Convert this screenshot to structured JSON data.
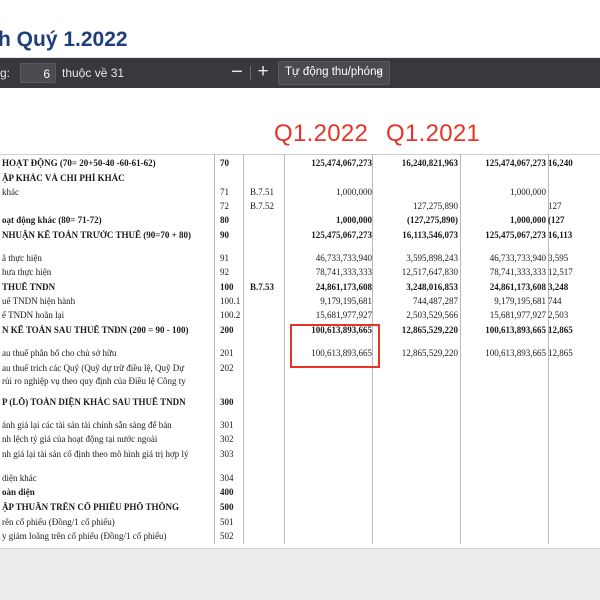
{
  "header": {
    "title": "h Quý 1.2022"
  },
  "toolbar": {
    "page_label": "g:",
    "page_value": "6",
    "page_of": "thuộc về 31",
    "zoom_out": "−",
    "zoom_in": "+",
    "zoom_select": "Tự động thu/phóng"
  },
  "annotations": {
    "q1_2022": "Q1.2022",
    "q1_2021": "Q1.2021"
  },
  "table": {
    "rows": [
      {
        "label": "HOẠT ĐỘNG (70= 20+50-40 -60-61-62)",
        "code": "70",
        "note": "",
        "v1": "125,474,067,273",
        "v2": "16,240,821,963",
        "v3": "125,474,067,273",
        "v4": "16,240",
        "bold": true
      },
      {
        "label": "ẬP KHÁC VÀ CHI PHÍ KHÁC",
        "code": "",
        "note": "",
        "v1": "",
        "v2": "",
        "v3": "",
        "v4": "",
        "bold": true
      },
      {
        "label": "khác",
        "code": "71",
        "note": "B.7.51",
        "v1": "1,000,000",
        "v2": "",
        "v3": "1,000,000",
        "v4": "",
        "bold": false
      },
      {
        "label": "",
        "code": "72",
        "note": "B.7.52",
        "v1": "",
        "v2": "127,275,890",
        "v3": "",
        "v4": "127",
        "bold": false
      },
      {
        "label": "oạt động khác (80= 71-72)",
        "code": "80",
        "note": "",
        "v1": "1,000,000",
        "v2": "(127,275,890)",
        "v3": "1,000,000",
        "v4": "(127",
        "bold": true
      },
      {
        "label": "NHUẬN KẾ TOÁN TRƯỚC THUẾ (90=70 + 80)",
        "code": "90",
        "note": "",
        "v1": "125,475,067,273",
        "v2": "16,113,546,073",
        "v3": "125,475,067,273",
        "v4": "16,113",
        "bold": true
      },
      {
        "label": "ã thực hiện",
        "code": "91",
        "note": "",
        "v1": "46,733,733,940",
        "v2": "3,595,898,243",
        "v3": "46,733,733,940",
        "v4": "3,595",
        "bold": false
      },
      {
        "label": "hưa thực hiện",
        "code": "92",
        "note": "",
        "v1": "78,741,333,333",
        "v2": "12,517,647,830",
        "v3": "78,741,333,333",
        "v4": "12,517",
        "bold": false
      },
      {
        "label": "THUẾ TNDN",
        "code": "100",
        "note": "B.7.53",
        "v1": "24,861,173,608",
        "v2": "3,248,016,853",
        "v3": "24,861,173,608",
        "v4": "3,248",
        "bold": true
      },
      {
        "label": "uế TNDN hiện hành",
        "code": "100.1",
        "note": "",
        "v1": "9,179,195,681",
        "v2": "744,487,287",
        "v3": "9,179,195,681",
        "v4": "744",
        "bold": false
      },
      {
        "label": "ế TNDN hoãn lại",
        "code": "100.2",
        "note": "",
        "v1": "15,681,977,927",
        "v2": "2,503,529,566",
        "v3": "15,681,977,927",
        "v4": "2,503",
        "bold": false
      },
      {
        "label": "N KẾ TOÁN SAU THUẾ TNDN (200 = 90 - 100)",
        "code": "200",
        "note": "",
        "v1": "100,613,893,665",
        "v2": "12,865,529,220",
        "v3": "100,613,893,665",
        "v4": "12,865",
        "bold": true
      },
      {
        "label": "au thuế phân bổ cho chủ sở hữu",
        "code": "201",
        "note": "",
        "v1": "100,613,893,665",
        "v2": "12,865,529,220",
        "v3": "100,613,893,665",
        "v4": "12,865",
        "bold": false
      },
      {
        "label": "au thuế trích các Quỹ (Quỹ dự trữ điều lệ, Quỹ Dự",
        "code": "202",
        "note": "",
        "v1": "",
        "v2": "",
        "v3": "",
        "v4": "",
        "bold": false
      },
      {
        "label": "rủi ro nghiệp vụ theo quy định của Điều lệ Công ty",
        "code": "",
        "note": "",
        "v1": "",
        "v2": "",
        "v3": "",
        "v4": "",
        "bold": false
      },
      {
        "label": "P (LỖ) TOÀN DIỆN KHÁC SAU THUẾ TNDN",
        "code": "300",
        "note": "",
        "v1": "",
        "v2": "",
        "v3": "",
        "v4": "",
        "bold": true
      },
      {
        "label": "ánh giá lại các tài sản tài chính sẵn sàng để bán",
        "code": "301",
        "note": "",
        "v1": "",
        "v2": "",
        "v3": "",
        "v4": "",
        "bold": false
      },
      {
        "label": "nh lệch tỷ giá của hoạt động tại nước ngoài",
        "code": "302",
        "note": "",
        "v1": "",
        "v2": "",
        "v3": "",
        "v4": "",
        "bold": false
      },
      {
        "label": "nh giá lại tài sản cố định theo mô hình giá trị hợp lý",
        "code": "303",
        "note": "",
        "v1": "",
        "v2": "",
        "v3": "",
        "v4": "",
        "bold": false
      },
      {
        "label": "diện khác",
        "code": "304",
        "note": "",
        "v1": "",
        "v2": "",
        "v3": "",
        "v4": "",
        "bold": false
      },
      {
        "label": "oàn diện",
        "code": "400",
        "note": "",
        "v1": "",
        "v2": "",
        "v3": "",
        "v4": "",
        "bold": true
      },
      {
        "label": "ẬP THUẦN TRÊN CỔ PHIẾU PHỔ THÔNG",
        "code": "500",
        "note": "",
        "v1": "",
        "v2": "",
        "v3": "",
        "v4": "",
        "bold": true
      },
      {
        "label": "rên cổ phiếu (Đồng/1 cổ phiếu)",
        "code": "501",
        "note": "",
        "v1": "",
        "v2": "",
        "v3": "",
        "v4": "",
        "bold": false
      },
      {
        "label": "y giảm loãng trên cổ phiếu (Đồng/1 cổ phiếu)",
        "code": "502",
        "note": "",
        "v1": "",
        "v2": "",
        "v3": "",
        "v4": "",
        "bold": false
      }
    ]
  }
}
